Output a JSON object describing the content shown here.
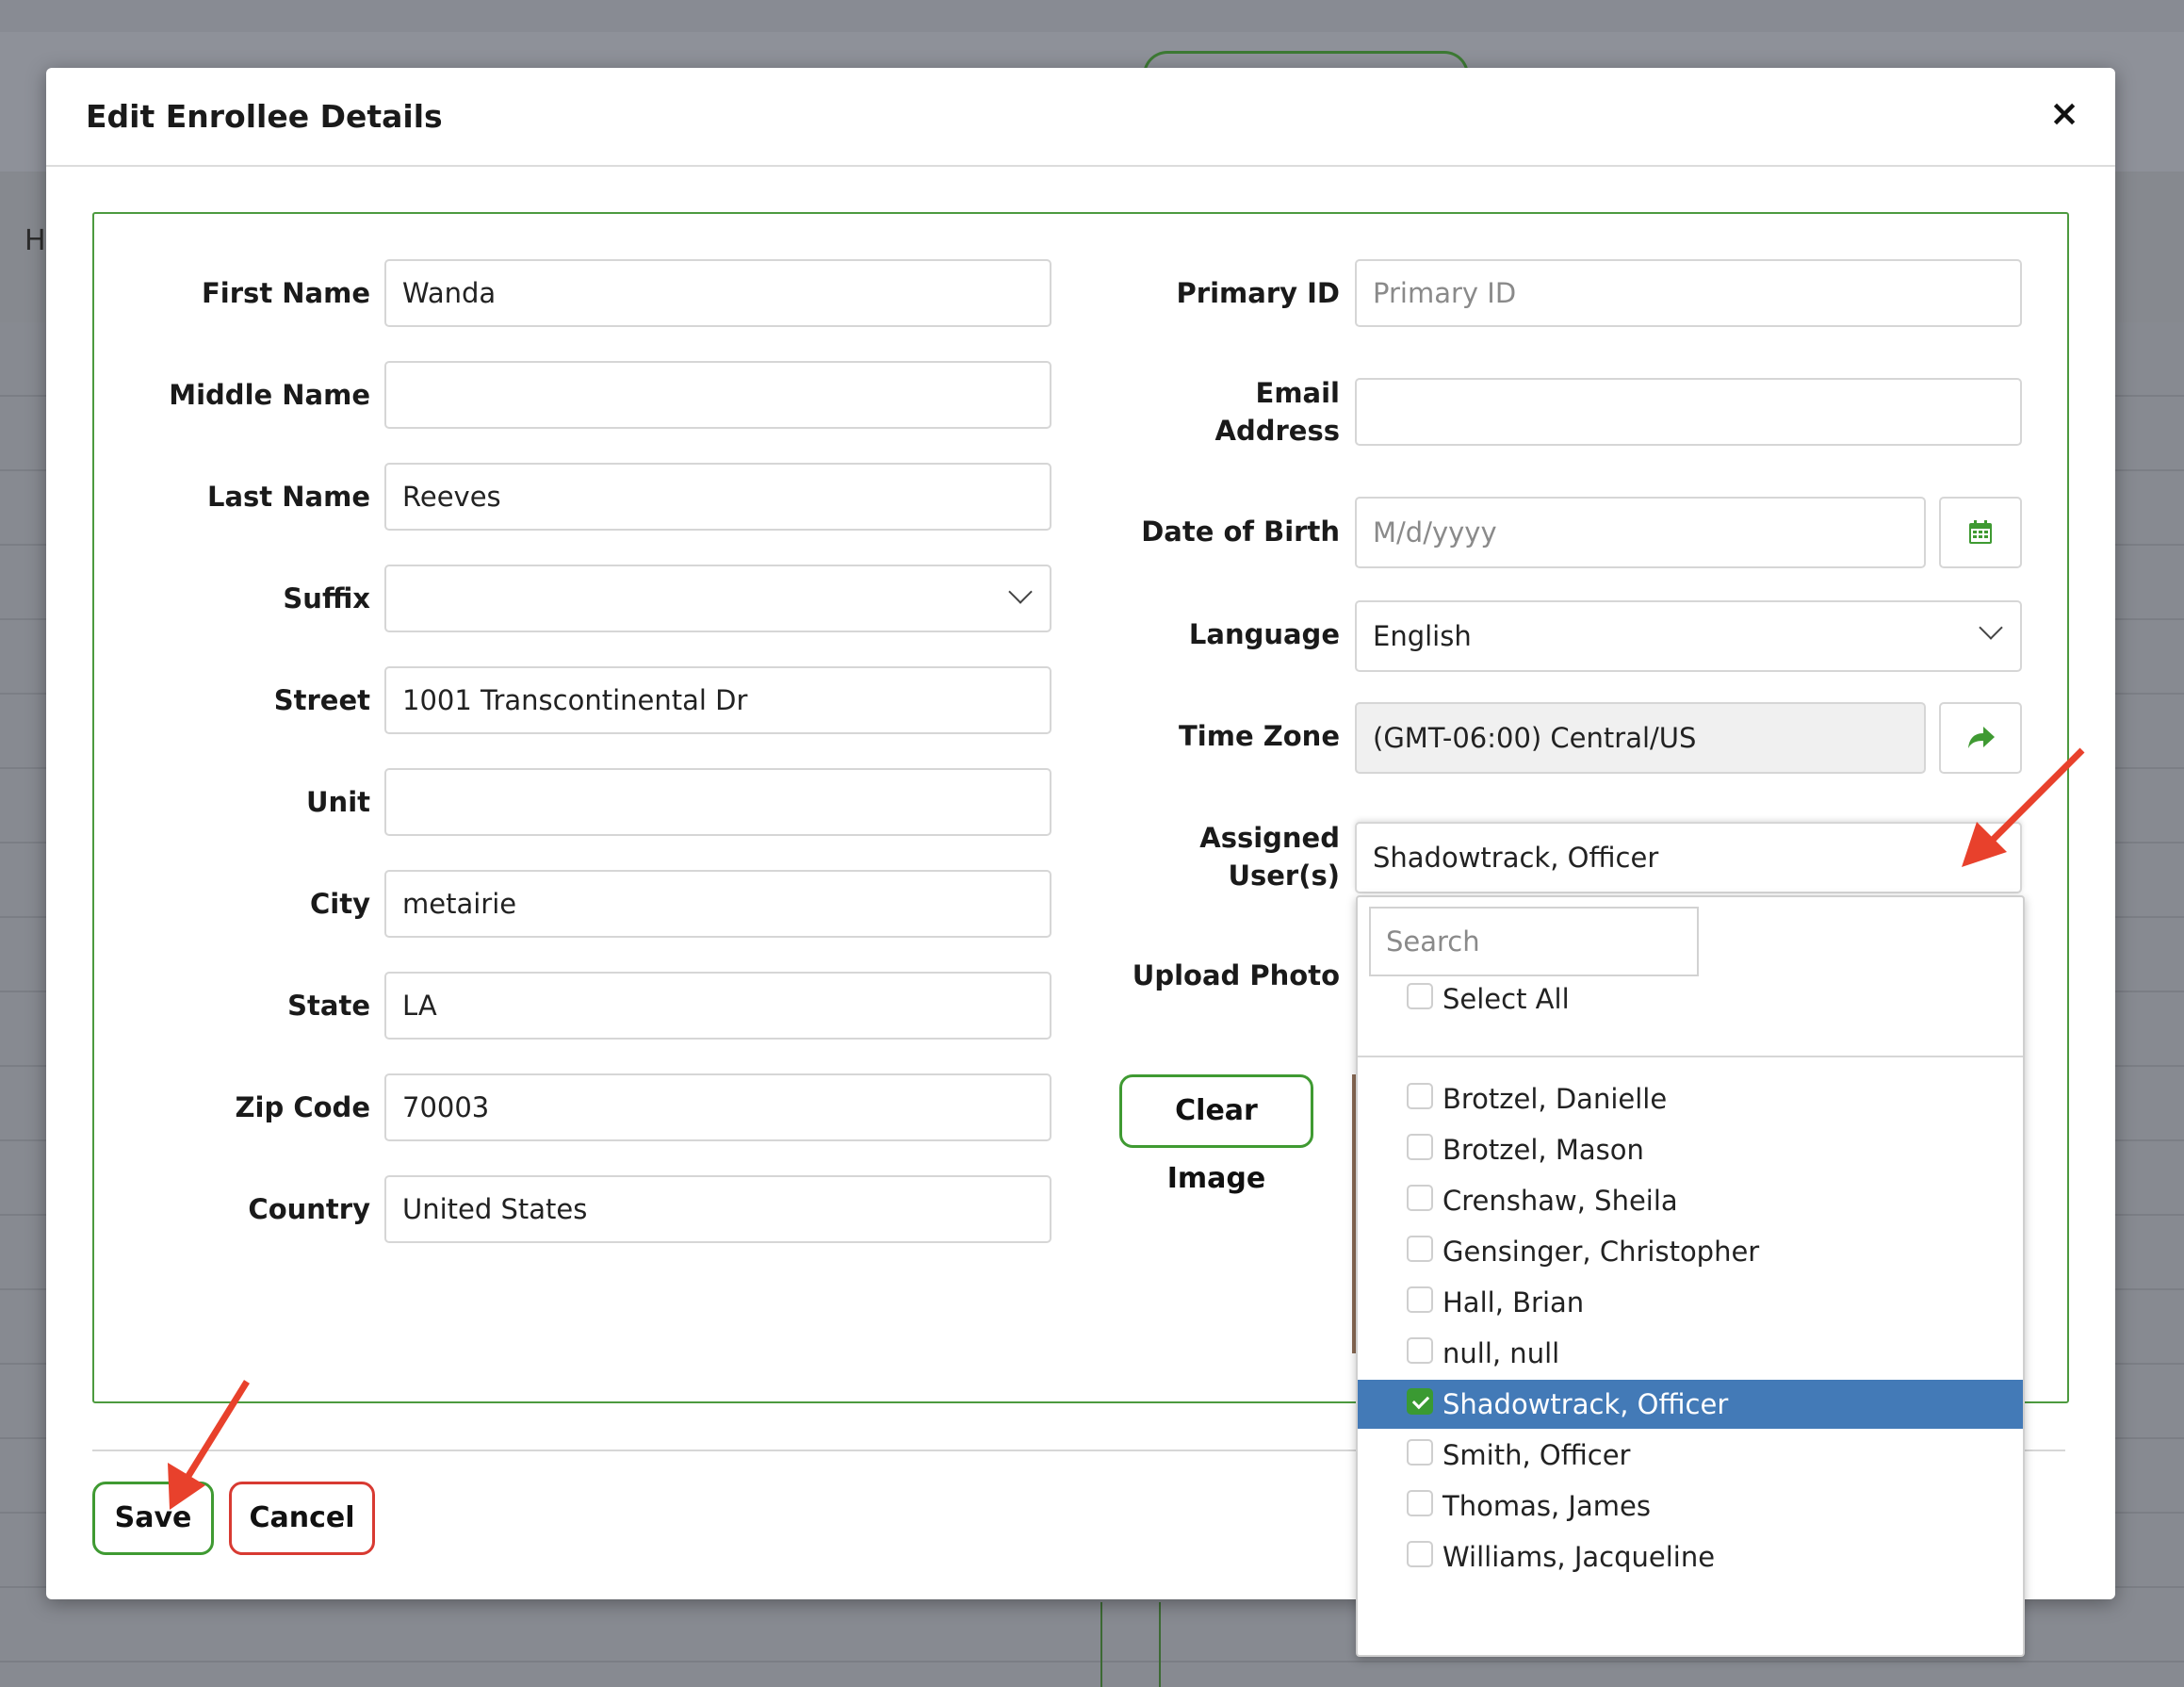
{
  "modal": {
    "title": "Edit Enrollee Details",
    "close_glyph": "×"
  },
  "background": {
    "nav_letter": "H"
  },
  "left_fields": [
    {
      "label": "First Name",
      "value": "Wanda"
    },
    {
      "label": "Middle Name",
      "value": ""
    },
    {
      "label": "Last Name",
      "value": "Reeves"
    },
    {
      "label": "Suffix",
      "value": ""
    },
    {
      "label": "Street",
      "value": "1001 Transcontinental Dr"
    },
    {
      "label": "Unit",
      "value": ""
    },
    {
      "label": "City",
      "value": "metairie"
    },
    {
      "label": "State",
      "value": "LA"
    },
    {
      "label": "Zip Code",
      "value": "70003"
    },
    {
      "label": "Country",
      "value": "United States"
    }
  ],
  "right_fields": {
    "primary_id": {
      "label": "Primary ID",
      "placeholder": "Primary ID"
    },
    "email": {
      "label_line1": "Email",
      "label_line2": "Address",
      "value": ""
    },
    "dob": {
      "label": "Date of Birth",
      "placeholder": "M/d/yyyy",
      "icon": "calendar-icon"
    },
    "language": {
      "label": "Language",
      "value": "English"
    },
    "timezone": {
      "label": "Time Zone",
      "value": "(GMT-06:00) Central/US",
      "icon": "share-arrow-icon"
    },
    "assigned": {
      "label_line1": "Assigned",
      "label_line2": "User(s)",
      "value": "Shadowtrack, Officer"
    },
    "upload_photo": {
      "label": "Upload Photo"
    },
    "clear_image": "Clear Image"
  },
  "dropdown": {
    "search_placeholder": "Search",
    "select_all": "Select All",
    "options": [
      {
        "label": "Brotzel, Danielle",
        "checked": false
      },
      {
        "label": "Brotzel, Mason",
        "checked": false
      },
      {
        "label": "Crenshaw, Sheila",
        "checked": false
      },
      {
        "label": "Gensinger, Christopher",
        "checked": false
      },
      {
        "label": "Hall, Brian",
        "checked": false
      },
      {
        "label": "null, null",
        "checked": false
      },
      {
        "label": "Shadowtrack, Officer",
        "checked": true
      },
      {
        "label": "Smith, Officer",
        "checked": false
      },
      {
        "label": "Thomas, James",
        "checked": false
      },
      {
        "label": "Williams, Jacqueline",
        "checked": false
      }
    ]
  },
  "footer": {
    "save": "Save",
    "cancel": "Cancel"
  },
  "colors": {
    "accent_green": "#3f9a32",
    "danger_red": "#d83a32",
    "selection_blue": "#437ab7",
    "annotation_arrow": "#e8412c"
  }
}
